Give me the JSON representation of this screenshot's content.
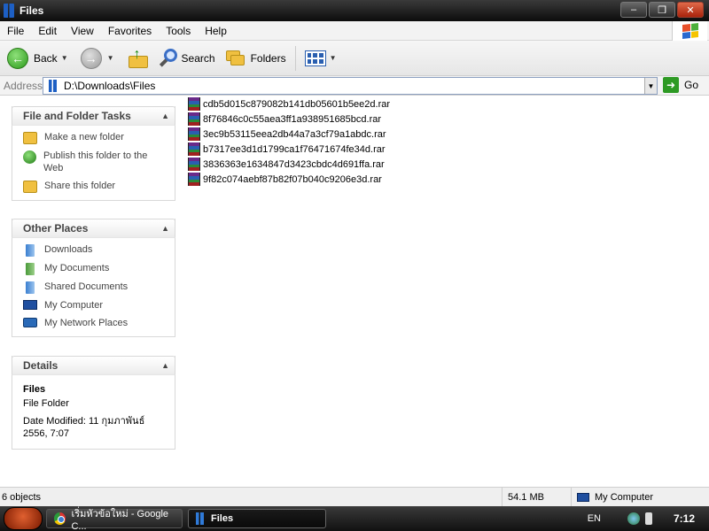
{
  "window": {
    "title": "Files",
    "minimize": "–",
    "maximize": "❐",
    "close": "✕"
  },
  "menu": [
    "File",
    "Edit",
    "View",
    "Favorites",
    "Tools",
    "Help"
  ],
  "toolbar": {
    "back": "Back",
    "search": "Search",
    "folders": "Folders"
  },
  "address": {
    "label": "Address",
    "path": "D:\\Downloads\\Files",
    "go": "Go"
  },
  "tasks_panel": {
    "title": "File and Folder Tasks",
    "items": [
      "Make a new folder",
      "Publish this folder to the Web",
      "Share this folder"
    ]
  },
  "places_panel": {
    "title": "Other Places",
    "items": [
      "Downloads",
      "My Documents",
      "Shared Documents",
      "My Computer",
      "My Network Places"
    ]
  },
  "details_panel": {
    "title": "Details",
    "name": "Files",
    "type": "File Folder",
    "modified": "Date Modified: 11 กุมภาพันธ์ 2556, 7:07"
  },
  "files": [
    "cdb5d015c879082b141db05601b5ee2d.rar",
    "8f76846c0c55aea3ff1a938951685bcd.rar",
    "3ec9b53115eea2db44a7a3cf79a1abdc.rar",
    "b7317ee3d1d1799ca1f76471674fe34d.rar",
    "3836363e1634847d3423cbdc4d691ffa.rar",
    "9f82c074aebf87b82f07b040c9206e3d.rar"
  ],
  "status": {
    "objects": "6 objects",
    "size": "54.1 MB",
    "location": "My Computer"
  },
  "taskbar": {
    "chrome_task": "เริ่มหัวข้อใหม่ - Google C...",
    "files_task": "Files",
    "lang": "EN",
    "clock": "7:12"
  }
}
